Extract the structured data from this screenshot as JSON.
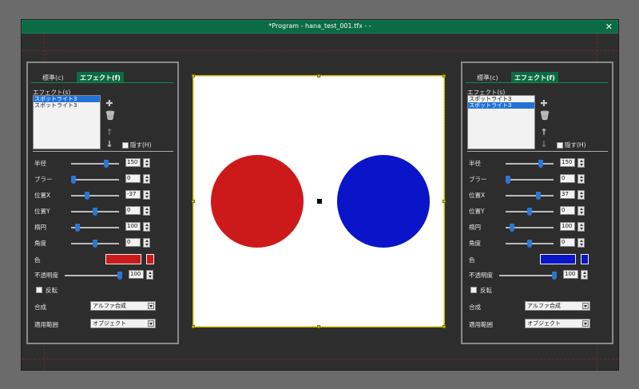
{
  "window": {
    "title": "*Program - hana_test_001.tfx - -",
    "close": "✕"
  },
  "tabs": {
    "standard": "標準(c)",
    "effect": "エフェクト(f)"
  },
  "left": {
    "effects_label": "エフェクト(s)",
    "effects": [
      "スポットライト3",
      "スポットライト3"
    ],
    "selected_index": 0,
    "hide_label": "隠す(H)",
    "params": [
      {
        "label": "半径",
        "value": "150",
        "pos": 0.75
      },
      {
        "label": "ブラー",
        "value": "0",
        "pos": 0.0
      },
      {
        "label": "位置X",
        "value": "-37",
        "pos": 0.3
      },
      {
        "label": "位置Y",
        "value": "0",
        "pos": 0.5
      },
      {
        "label": "楕円",
        "value": "100",
        "pos": 0.1
      },
      {
        "label": "角度",
        "value": "0",
        "pos": 0.5
      }
    ],
    "color_label": "色",
    "color": "#cc1a1a",
    "opacity_label": "不透明度",
    "opacity_value": "100",
    "opacity_pos": 1.0,
    "invert_label": "反転",
    "blend_label": "合成",
    "blend_value": "アルファ合成",
    "scope_label": "適用範囲",
    "scope_value": "オブジェクト"
  },
  "right": {
    "effects_label": "エフェクト(s)",
    "effects": [
      "スポットライト3",
      "スポットライト3"
    ],
    "selected_index": 1,
    "hide_label": "隠す(H)",
    "params": [
      {
        "label": "半径",
        "value": "150",
        "pos": 0.75
      },
      {
        "label": "ブラー",
        "value": "0",
        "pos": 0.0
      },
      {
        "label": "位置X",
        "value": "37",
        "pos": 0.7
      },
      {
        "label": "位置Y",
        "value": "0",
        "pos": 0.5
      },
      {
        "label": "楕円",
        "value": "100",
        "pos": 0.1
      },
      {
        "label": "角度",
        "value": "0",
        "pos": 0.5
      }
    ],
    "color_label": "色",
    "color": "#0a14c8",
    "opacity_label": "不透明度",
    "opacity_value": "100",
    "opacity_pos": 1.0,
    "invert_label": "反転",
    "blend_label": "合成",
    "blend_value": "アルファ合成",
    "scope_label": "適用範囲",
    "scope_value": "オブジェクト"
  },
  "canvas": {
    "left_circle_color": "#cc1a1a",
    "right_circle_color": "#0a14c8"
  }
}
